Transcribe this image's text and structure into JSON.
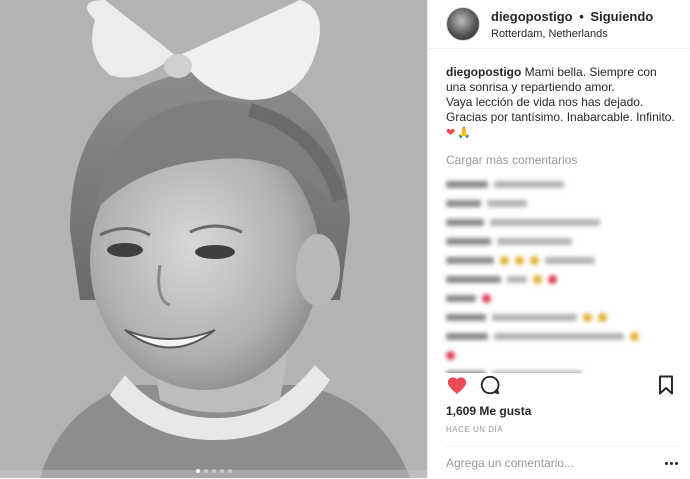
{
  "header": {
    "username": "diegopostigo",
    "separator": "•",
    "follow_status": "Siguiendo",
    "location": "Rotterdam, Netherlands"
  },
  "caption": {
    "username": "diegopostigo",
    "lines": [
      "Mami bella. Siempre con una sonrisa y repartiendo amor.",
      "Vaya lección de vida nos has dejado.",
      "Gracias por tantísimo. Inabarcable. Infinito."
    ],
    "emojis": [
      "❤",
      "🙏"
    ]
  },
  "load_more_label": "Cargar más comentarios",
  "likes_label": "1,609 Me gusta",
  "time_label": "HACE UN DÍA",
  "comment_placeholder": "Agrega un comentario...",
  "carousel_count": 5,
  "carousel_active": 0,
  "icons": {
    "like": "heart-filled-icon",
    "comment": "speech-bubble-icon",
    "save": "bookmark-icon",
    "more": "more-options-icon"
  },
  "colors": {
    "like": "#ed4956",
    "text": "#262626",
    "muted": "#999999"
  }
}
